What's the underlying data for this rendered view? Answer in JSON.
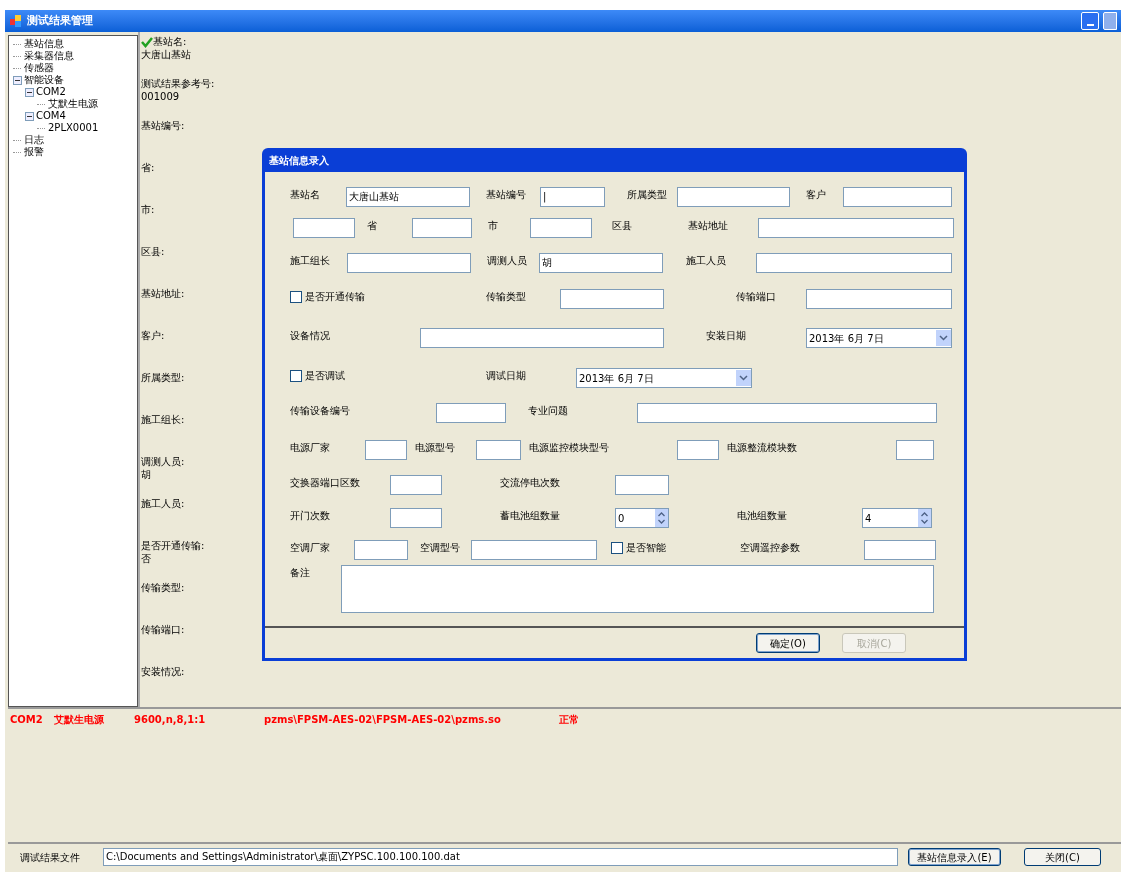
{
  "window": {
    "title": "测试结果管理"
  },
  "tree": [
    {
      "label": "基站信息"
    },
    {
      "label": "采集器信息"
    },
    {
      "label": "传感器"
    },
    {
      "label": "智能设备",
      "expanded": true,
      "children": [
        {
          "label": "COM2",
          "expanded": true,
          "children": [
            {
              "label": "艾默生电源"
            }
          ]
        },
        {
          "label": "COM4",
          "expanded": true,
          "children": [
            {
              "label": "2PLX0001"
            }
          ]
        }
      ]
    },
    {
      "label": "日志"
    },
    {
      "label": "报警"
    }
  ],
  "details": [
    {
      "label": "基站名:",
      "value": "大唐山基站",
      "checked": true
    },
    {
      "label": "测试结果参考号:",
      "value": "001009"
    },
    {
      "label": "基站编号:"
    },
    {
      "label": "省:"
    },
    {
      "label": "市:"
    },
    {
      "label": "区县:"
    },
    {
      "label": "基站地址:"
    },
    {
      "label": "客户:"
    },
    {
      "label": "所属类型:"
    },
    {
      "label": "施工组长:"
    },
    {
      "label": "调测人员:",
      "value": "胡"
    },
    {
      "label": "施工人员:"
    },
    {
      "label": "是否开通传输:",
      "value": "否"
    },
    {
      "label": "传输类型:"
    },
    {
      "label": "传输端口:"
    },
    {
      "label": "安装情况:"
    }
  ],
  "dialog": {
    "title": "基站信息录入",
    "form_lines": [
      {
        "items": [
          {
            "kind": "label",
            "text": "基站名"
          },
          {
            "kind": "input",
            "value": "大唐山基站"
          },
          {
            "kind": "label",
            "text": "基站编号"
          },
          {
            "kind": "input",
            "value": "|"
          },
          {
            "kind": "label",
            "text": "所属类型"
          },
          {
            "kind": "input"
          },
          {
            "kind": "label",
            "text": "客户"
          },
          {
            "kind": "input"
          }
        ]
      },
      {
        "items": [
          {
            "kind": "input"
          },
          {
            "kind": "label",
            "text": "省"
          },
          {
            "kind": "input"
          },
          {
            "kind": "label",
            "text": "市"
          },
          {
            "kind": "input"
          },
          {
            "kind": "label",
            "text": "区县"
          },
          {
            "kind": "label",
            "text": "基站地址"
          },
          {
            "kind": "input"
          }
        ]
      },
      {
        "items": [
          {
            "kind": "label",
            "text": "施工组长"
          },
          {
            "kind": "input"
          },
          {
            "kind": "label",
            "text": "调测人员"
          },
          {
            "kind": "input",
            "value": "胡"
          },
          {
            "kind": "label",
            "text": "施工人员"
          },
          {
            "kind": "input"
          }
        ]
      },
      {
        "items": [
          {
            "kind": "checkbox",
            "text": "是否开通传输",
            "checked": false
          },
          {
            "kind": "label",
            "text": "传输类型"
          },
          {
            "kind": "input"
          },
          {
            "kind": "label",
            "text": "传输端口"
          },
          {
            "kind": "input"
          }
        ]
      },
      {
        "items": [
          {
            "kind": "label",
            "text": "设备情况"
          },
          {
            "kind": "input"
          },
          {
            "kind": "label",
            "text": "安装日期"
          },
          {
            "kind": "date",
            "value": "2013年 6月 7日"
          }
        ]
      },
      {
        "items": [
          {
            "kind": "checkbox",
            "text": "是否调试",
            "checked": false
          },
          {
            "kind": "label",
            "text": "调试日期"
          },
          {
            "kind": "date",
            "value": "2013年 6月 7日"
          }
        ]
      },
      {
        "items": [
          {
            "kind": "label",
            "text": "传输设备编号"
          },
          {
            "kind": "input"
          },
          {
            "kind": "label",
            "text": "专业问题"
          },
          {
            "kind": "input"
          }
        ]
      },
      {
        "items": [
          {
            "kind": "label",
            "text": "电源厂家"
          },
          {
            "kind": "input"
          },
          {
            "kind": "label",
            "text": "电源型号"
          },
          {
            "kind": "input"
          },
          {
            "kind": "label",
            "text": "电源监控模块型号"
          },
          {
            "kind": "input"
          },
          {
            "kind": "label",
            "text": "电源整流模块数"
          },
          {
            "kind": "input"
          }
        ]
      },
      {
        "items": [
          {
            "kind": "label",
            "text": "交换器端口区数"
          },
          {
            "kind": "input"
          },
          {
            "kind": "label",
            "text": "交流停电次数"
          },
          {
            "kind": "input"
          }
        ]
      },
      {
        "items": [
          {
            "kind": "label",
            "text": "开门次数"
          },
          {
            "kind": "input"
          },
          {
            "kind": "label",
            "text": "蓄电池组数量"
          },
          {
            "kind": "spin",
            "value": "0"
          },
          {
            "kind": "label",
            "text": "电池组数量"
          },
          {
            "kind": "spin",
            "value": "4"
          }
        ]
      },
      {
        "items": [
          {
            "kind": "label",
            "text": "空调厂家"
          },
          {
            "kind": "input"
          },
          {
            "kind": "label",
            "text": "空调型号"
          },
          {
            "kind": "input"
          },
          {
            "kind": "checkbox",
            "text": "是否智能",
            "checked": false
          },
          {
            "kind": "label",
            "text": "空调遥控参数"
          },
          {
            "kind": "input"
          }
        ]
      },
      {
        "items": [
          {
            "kind": "label",
            "text": "备注"
          },
          {
            "kind": "textarea"
          }
        ]
      }
    ],
    "buttons": [
      {
        "label": "确定(O)",
        "disabled": false
      },
      {
        "label": "取消(C)",
        "disabled": true
      }
    ]
  },
  "log": [
    "COM2",
    "艾默生电源",
    "9600,n,8,1:1",
    "pzms\\FPSM-AES-02\\FPSM-AES-02\\pzms.so",
    "正常"
  ],
  "result_file": {
    "label": "调试结果文件",
    "value": "C:\\Documents and Settings\\Administrator\\桌面\\ZYPSC.100.100.100.dat"
  },
  "buttons": [
    "基站信息录入(E)",
    "关闭(C)"
  ]
}
